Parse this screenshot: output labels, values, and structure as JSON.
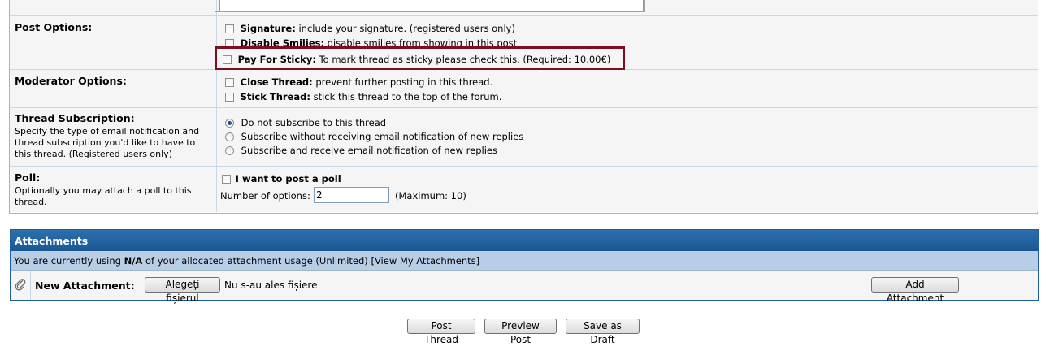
{
  "post_options": {
    "label": "Post Options:",
    "items": [
      {
        "title": "Signature:",
        "desc": "include your signature. (registered users only)"
      },
      {
        "title": "Disable Smilies:",
        "desc": "disable smilies from showing in this post"
      },
      {
        "title": "Pay For Sticky:",
        "desc": "To mark thread as sticky please check this. (Required: 10.00€)"
      }
    ]
  },
  "moderator_options": {
    "label": "Moderator Options:",
    "items": [
      {
        "title": "Close Thread:",
        "desc": "prevent further posting in this thread."
      },
      {
        "title": "Stick Thread:",
        "desc": "stick this thread to the top of the forum."
      }
    ]
  },
  "subscription": {
    "label": "Thread Subscription:",
    "desc": "Specify the type of email notification and thread subscription you'd like to have to this thread. (Registered users only)",
    "options": [
      "Do not subscribe to this thread",
      "Subscribe without receiving email notification of new replies",
      "Subscribe and receive email notification of new replies"
    ]
  },
  "poll": {
    "label": "Poll:",
    "desc": "Optionally you may attach a poll to this thread.",
    "checkbox_label": "I want to post a poll",
    "num_options_label": "Number of options:",
    "num_options_value": "2",
    "max_note": "(Maximum: 10)"
  },
  "attachments": {
    "title": "Attachments",
    "usage_prefix": "You are currently using",
    "usage_value": "N/A",
    "usage_suffix": "of your allocated attachment usage (Unlimited)",
    "view_link": "[View My Attachments]",
    "new_label": "New Attachment:",
    "browse_button": "Alegeți fișierul",
    "no_file_text": "Nu s-au ales fișiere",
    "add_button": "Add Attachment"
  },
  "buttons": {
    "post": "Post Thread",
    "preview": "Preview Post",
    "draft": "Save as Draft"
  },
  "colors": {
    "header_blue": "#1f5e9c",
    "subheader_blue": "#b8cde6",
    "highlight_border": "#7a0f1d",
    "cell_bg": "#f5f5f5",
    "border": "#c9d7e6"
  }
}
